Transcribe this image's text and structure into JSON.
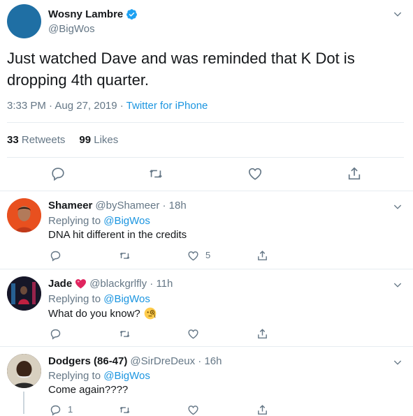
{
  "tweet": {
    "display_name": "Wosny Lambre",
    "handle": "@BigWos",
    "text": "Just watched Dave and was reminded that K Dot is dropping 4th quarter.",
    "time": "3:33 PM · Aug 27, 2019 · ",
    "source": "Twitter for iPhone",
    "retweets_count": "33",
    "retweets_label": "Retweets",
    "likes_count": "99",
    "likes_label": "Likes",
    "icons": [
      "chevron-down-icon",
      "verified-icon",
      "reply-icon",
      "retweet-icon",
      "like-icon",
      "share-icon"
    ]
  },
  "replies": [
    {
      "name": "Shameer",
      "handle": "@byShameer · 18h",
      "replying_prefix": "Replying to ",
      "replying_to": "@BigWos",
      "text": "DNA hit different in the credits",
      "reply_count": "",
      "retweet_count": "",
      "like_count": "5",
      "avatar_color": "#e8501f"
    },
    {
      "name": "Jade",
      "handle": "@blackgrlfly · 11h",
      "replying_prefix": "Replying to ",
      "replying_to": "@BigWos",
      "text": "What do you know?",
      "reply_count": "",
      "retweet_count": "",
      "like_count": "",
      "avatar_color": "#1a1a2e"
    },
    {
      "name": "Dodgers (86-47)",
      "handle": "@SirDreDeux · 16h",
      "replying_prefix": "Replying to ",
      "replying_to": "@BigWos",
      "text": "Come again????",
      "reply_count": "1",
      "retweet_count": "",
      "like_count": "",
      "avatar_color": "#3a2a1e"
    }
  ],
  "colors": {
    "link": "#1b95e0",
    "muted": "#657786",
    "text": "#14171a",
    "border": "#e6ecf0"
  }
}
